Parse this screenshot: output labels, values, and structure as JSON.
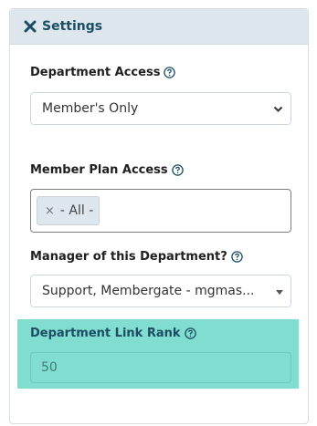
{
  "panel": {
    "title": "Settings",
    "close_icon": "close-x-icon",
    "accent_color": "#1c4d63",
    "highlight_color": "#80ddd0"
  },
  "fields": {
    "department_access": {
      "label": "Department Access",
      "help_icon": "question-circle-icon",
      "value": "Member's Only"
    },
    "member_plan_access": {
      "label": "Member Plan Access",
      "help_icon": "question-circle-icon",
      "tags": [
        "- All -"
      ],
      "tag_remove_glyph": "×"
    },
    "manager": {
      "label": "Manager of this Department?",
      "help_icon": "question-circle-icon",
      "value": "Support, Membergate - mgmas..."
    },
    "link_rank": {
      "label": "Department Link Rank",
      "help_icon": "question-circle-icon",
      "value": "50"
    }
  }
}
